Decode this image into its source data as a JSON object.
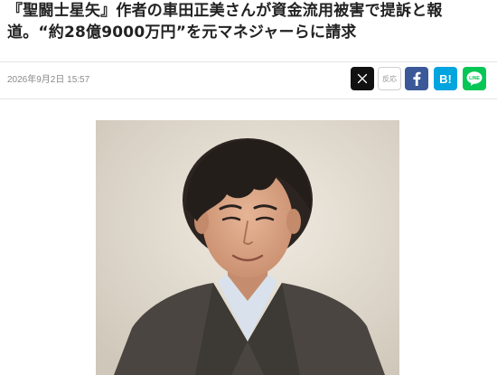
{
  "article": {
    "headline": "『聖闘士星矢』作者の車田正美さんが資金流用被害で提訴と報道。“約28億9000万円”を元マネジャーらに請求",
    "date": "2026年9月2日 15:57"
  },
  "share": {
    "x_icon": "x-logo-icon",
    "hanno_label": "反応",
    "facebook_icon": "facebook-icon",
    "hatena_label": "B!",
    "line_icon": "line-icon",
    "colors": {
      "x": "#111111",
      "facebook": "#3b5998",
      "hatena": "#00a4de",
      "line": "#06c755"
    }
  },
  "photo": {
    "subject": "portrait-photo"
  }
}
